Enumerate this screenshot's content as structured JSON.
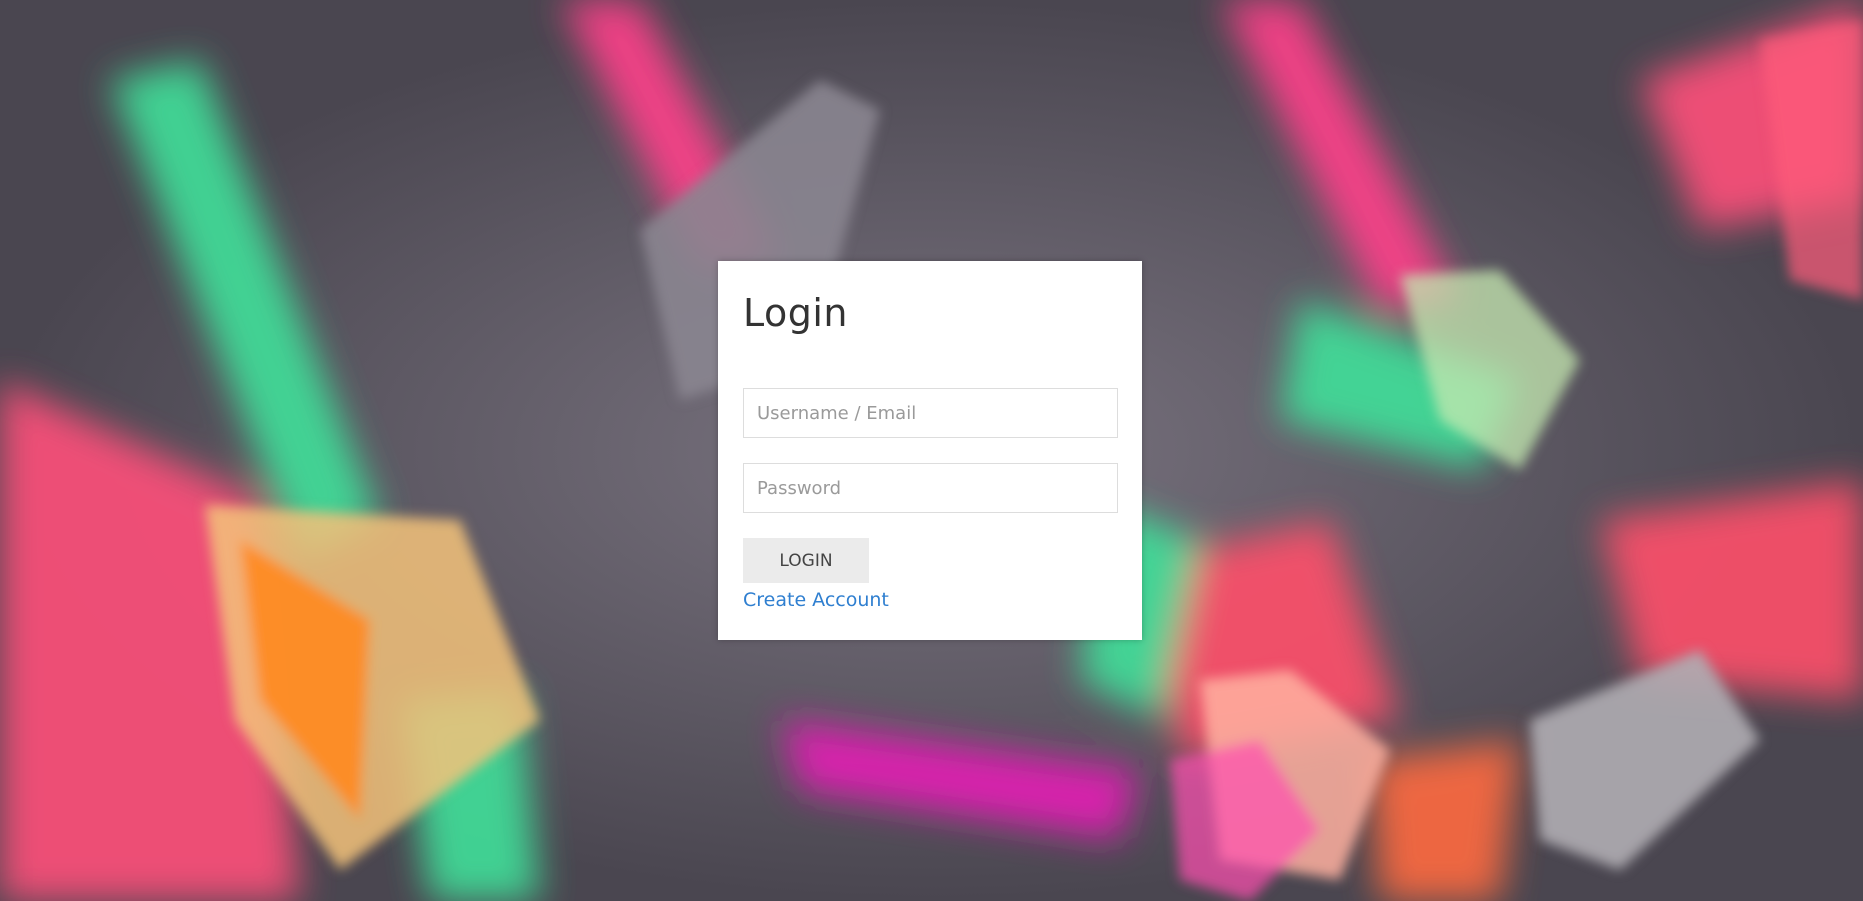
{
  "background": {
    "description_icon": "prism-light-background",
    "colors": {
      "base": "#55525a",
      "pink": "#ff4f7a",
      "green": "#3fe09a",
      "orange": "#ff8a1f",
      "magenta": "#e51fb5"
    }
  },
  "login": {
    "title": "Login",
    "username_placeholder": "Username / Email",
    "password_placeholder": "Password",
    "submit_label": "LOGIN",
    "create_account_label": "Create Account"
  },
  "colors": {
    "card_bg": "#ffffff",
    "button_bg": "#ebebeb",
    "link": "#2f7fd0",
    "title": "#333333"
  }
}
